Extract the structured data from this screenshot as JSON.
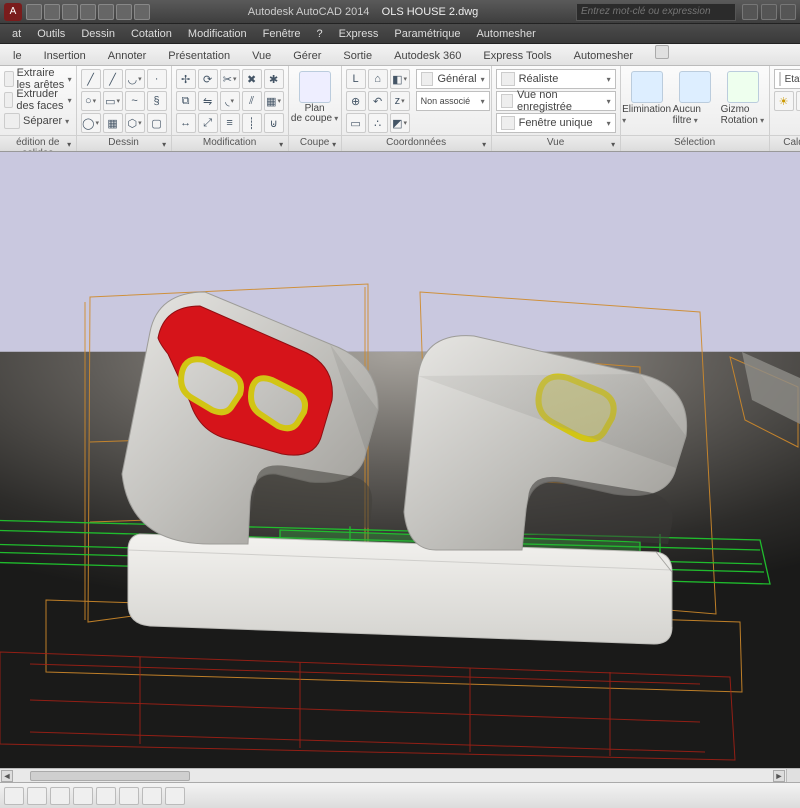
{
  "title": {
    "app": "Autodesk AutoCAD 2014",
    "file": "OLS HOUSE 2.dwg"
  },
  "search": {
    "placeholder": "Entrez mot-clé ou expression"
  },
  "menus": [
    "at",
    "Outils",
    "Dessin",
    "Cotation",
    "Modification",
    "Fenêtre",
    "?",
    "Express",
    "Paramétrique",
    "Automesher"
  ],
  "tabs": [
    "le",
    "Insertion",
    "Annoter",
    "Présentation",
    "Vue",
    "Gérer",
    "Sortie",
    "Autodesk 360",
    "Express Tools",
    "Automesher"
  ],
  "panel_solids": {
    "extract_edges": "Extraire les arêtes",
    "extrude_faces": "Extruder des faces",
    "separate": "Séparer",
    "title": "édition de solides"
  },
  "panel_dessin": {
    "title": "Dessin"
  },
  "panel_modification": {
    "title": "Modification"
  },
  "panel_coupe": {
    "big_label": "Plan\nde coupe",
    "title": "Coupe"
  },
  "panel_coord": {
    "style": "Général",
    "non_associated": "Non associé",
    "title": "Coordonnées"
  },
  "panel_vue": {
    "style1": "Réaliste",
    "style2": "Vue non enregistrée",
    "style3": "Fenêtre unique",
    "title": "Vue"
  },
  "panel_selection": {
    "btn1": "Elimination",
    "btn2": "Aucun filtre",
    "btn3": "Gizmo Rotation",
    "title": "Sélection"
  },
  "panel_calques": {
    "btn1": "Etat de calque non e",
    "title": "Calque"
  }
}
